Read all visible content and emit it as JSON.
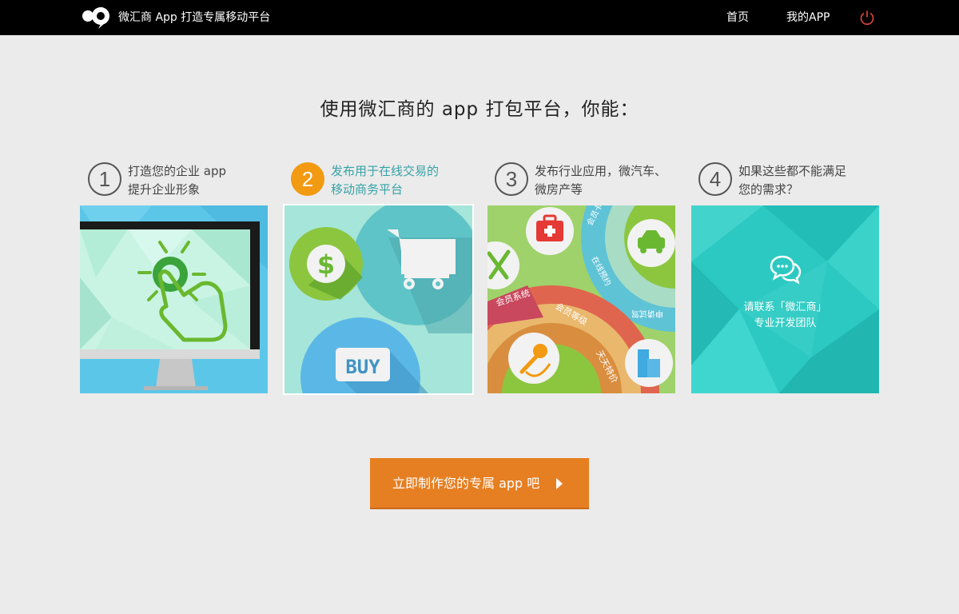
{
  "header": {
    "brand": "微汇商 App 打造专属移动平台",
    "nav": {
      "home": "首页",
      "my_app": "我的APP"
    },
    "power_color": "#e5473b"
  },
  "main": {
    "headline": "使用微汇商的 app 打包平台，你能："
  },
  "steps": [
    {
      "number": "1",
      "line1": "打造您的企业 app",
      "line2": "提升企业形象"
    },
    {
      "number": "2",
      "line1": "发布用于在线交易的",
      "line2": "移动商务平台"
    },
    {
      "number": "3",
      "line1": "发布行业应用，微汽车、",
      "line2": "微房产等"
    },
    {
      "number": "4",
      "line1": "如果这些都不能满足",
      "line2": "您的需求？"
    }
  ],
  "cards": {
    "buy_label": "BUY",
    "wheel": {
      "member_system": "会员系统",
      "member_level": "会员等级",
      "daily_special": "天天特价",
      "online_booking": "在线预约",
      "member_card": "会员卡",
      "trial_apply": "申请试驾"
    },
    "contact_line1": "请联系「微汇商」",
    "contact_line2": "专业开发团队"
  },
  "cta": {
    "label": "立即制作您的专属 app 吧"
  },
  "colors": {
    "active_step": "#f29a12",
    "active_text": "#36a2a6",
    "cta": "#e67f22"
  }
}
